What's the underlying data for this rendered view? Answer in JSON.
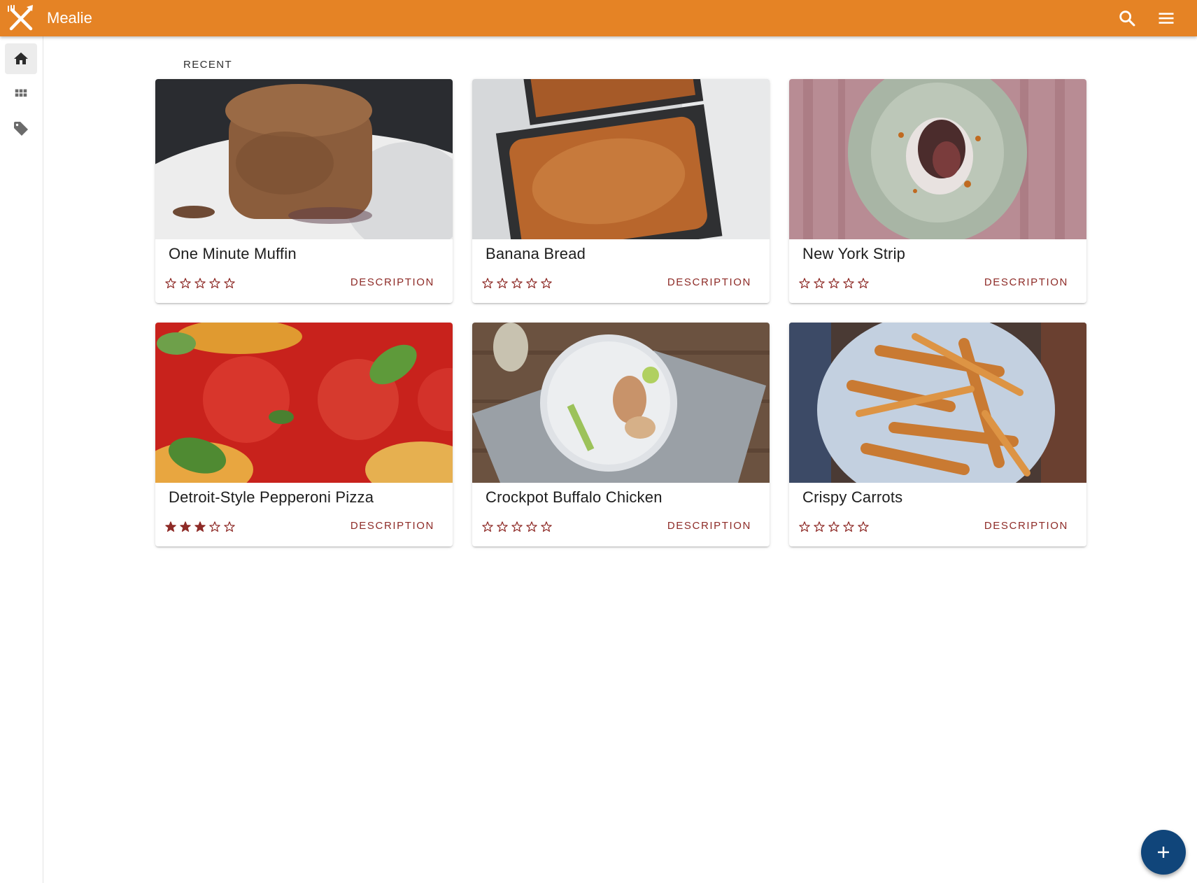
{
  "app": {
    "title": "Mealie"
  },
  "colors": {
    "primary": "#E58325",
    "accent": "#8E2B27",
    "fab": "#10457A"
  },
  "header": {
    "icons": [
      "search-icon",
      "menu-icon"
    ]
  },
  "sidebar": {
    "items": [
      {
        "name": "home",
        "icon": "home-icon",
        "active": true
      },
      {
        "name": "all-recipes",
        "icon": "grid-icon",
        "active": false
      },
      {
        "name": "categories",
        "icon": "tag-icon",
        "active": false
      }
    ]
  },
  "main": {
    "section_title": "RECENT",
    "recipes": [
      {
        "title": "One Minute Muffin",
        "rating": 0,
        "action": "DESCRIPTION"
      },
      {
        "title": "Banana Bread",
        "rating": 0,
        "action": "DESCRIPTION"
      },
      {
        "title": "New York Strip",
        "rating": 0,
        "action": "DESCRIPTION"
      },
      {
        "title": "Detroit-Style Pepperoni Pizza",
        "rating": 3,
        "action": "DESCRIPTION"
      },
      {
        "title": "Crockpot Buffalo Chicken",
        "rating": 0,
        "action": "DESCRIPTION"
      },
      {
        "title": "Crispy Carrots",
        "rating": 0,
        "action": "DESCRIPTION"
      }
    ]
  },
  "fab": {
    "icon": "plus-icon"
  }
}
